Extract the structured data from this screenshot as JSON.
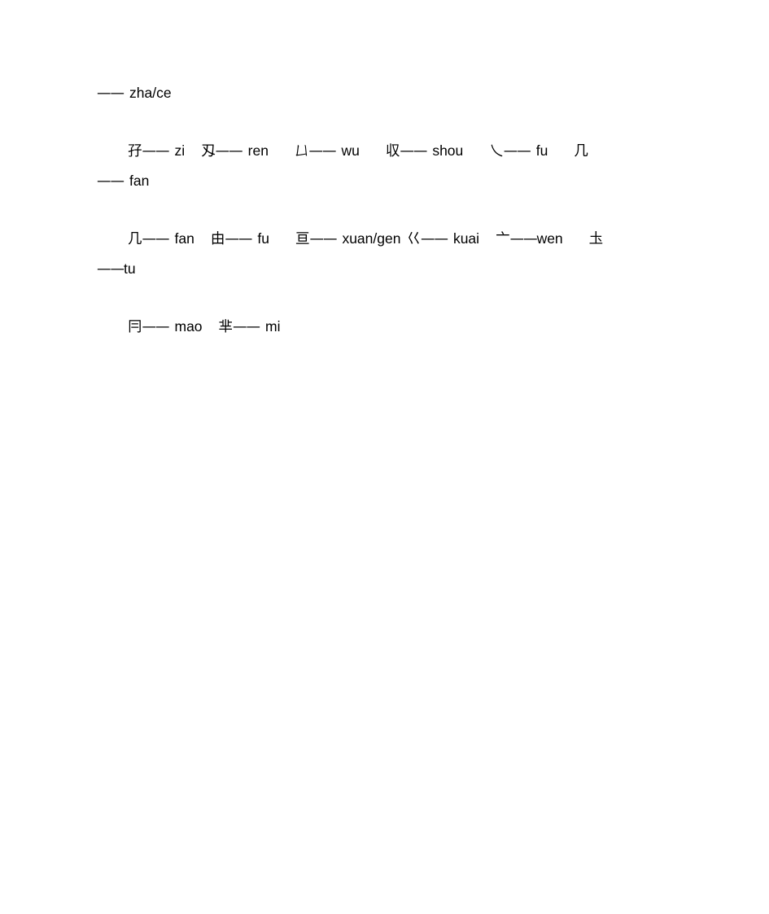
{
  "document": {
    "type": "character-pinyin-glossary",
    "background_color": "#ffffff",
    "text_color": "#000000",
    "paragraphs": [
      {
        "id": "p1",
        "indent": false,
        "entries": [
          {
            "char": "",
            "dash": "——",
            "pinyin": "zha/ce"
          }
        ],
        "raw": "—— zha/ce"
      },
      {
        "id": "p2",
        "indent": true,
        "entries": [
          {
            "char": "孖",
            "dash": "——",
            "pinyin": "zi"
          },
          {
            "char": "刄",
            "dash": "——",
            "pinyin": "ren"
          },
          {
            "char": "𠙴",
            "dash": "——",
            "pinyin": "wu"
          },
          {
            "char": "収",
            "dash": "——",
            "pinyin": "shou"
          },
          {
            "char": "乀",
            "dash": "——",
            "pinyin": "fu"
          },
          {
            "char": "几",
            "dash": "——",
            "pinyin": "fan"
          }
        ],
        "raw": "孖—— zi 刄—— ren 𠙴—— wu 収—— shou 乀—— fu 几 —— fan"
      },
      {
        "id": "p3",
        "indent": true,
        "entries": [
          {
            "char": "几",
            "dash": "——",
            "pinyin": "fan"
          },
          {
            "char": "由",
            "dash": "——",
            "pinyin": "fu"
          },
          {
            "char": "亘",
            "dash": "——",
            "pinyin": "xuan/gen"
          },
          {
            "char": "巜",
            "dash": "——",
            "pinyin": "kuai"
          },
          {
            "char": "亠",
            "dash": "——",
            "pinyin": "wen"
          },
          {
            "char": "圡",
            "dash": "——",
            "pinyin": "tu"
          }
        ],
        "raw": "几—— fan 由—— fu 亘—— xuan/gen 巜—— kuai 亠——wen 圡 ——tu"
      },
      {
        "id": "p4",
        "indent": true,
        "entries": [
          {
            "char": "冃",
            "dash": "——",
            "pinyin": "mao"
          },
          {
            "char": "芈",
            "dash": "——",
            "pinyin": "mi"
          }
        ],
        "raw": "冃—— mao 芈—— mi"
      }
    ],
    "line1": {
      "dash": "——",
      "pinyin": "zha/ce"
    },
    "line2": {
      "c1": "孖",
      "d1": "——",
      "p1": "zi",
      "c2": "刄",
      "d2": "——",
      "p2": "ren",
      "c3": "𠙴",
      "d3": "——",
      "p3": "wu",
      "c4": "収",
      "d4": "——",
      "p4": "shou",
      "c5": "乀",
      "d5": "——",
      "p5": "fu",
      "c6": "几",
      "d6": "——",
      "p6": "fan"
    },
    "line3": {
      "c1": "几",
      "d1": "——",
      "p1": "fan",
      "c2": "由",
      "d2": "——",
      "p2": "fu",
      "c3": "亘",
      "d3": "——",
      "p3": "xuan/gen",
      "c4": "巜",
      "d4": "——",
      "p4": "kuai",
      "c5": "亠",
      "d5": "——",
      "p5": "wen",
      "c6": "圡",
      "d6": "——",
      "p6": "tu"
    },
    "line4": {
      "c1": "冃",
      "d1": "——",
      "p1": "mao",
      "c2": "芈",
      "d2": "——",
      "p2": "mi"
    }
  }
}
